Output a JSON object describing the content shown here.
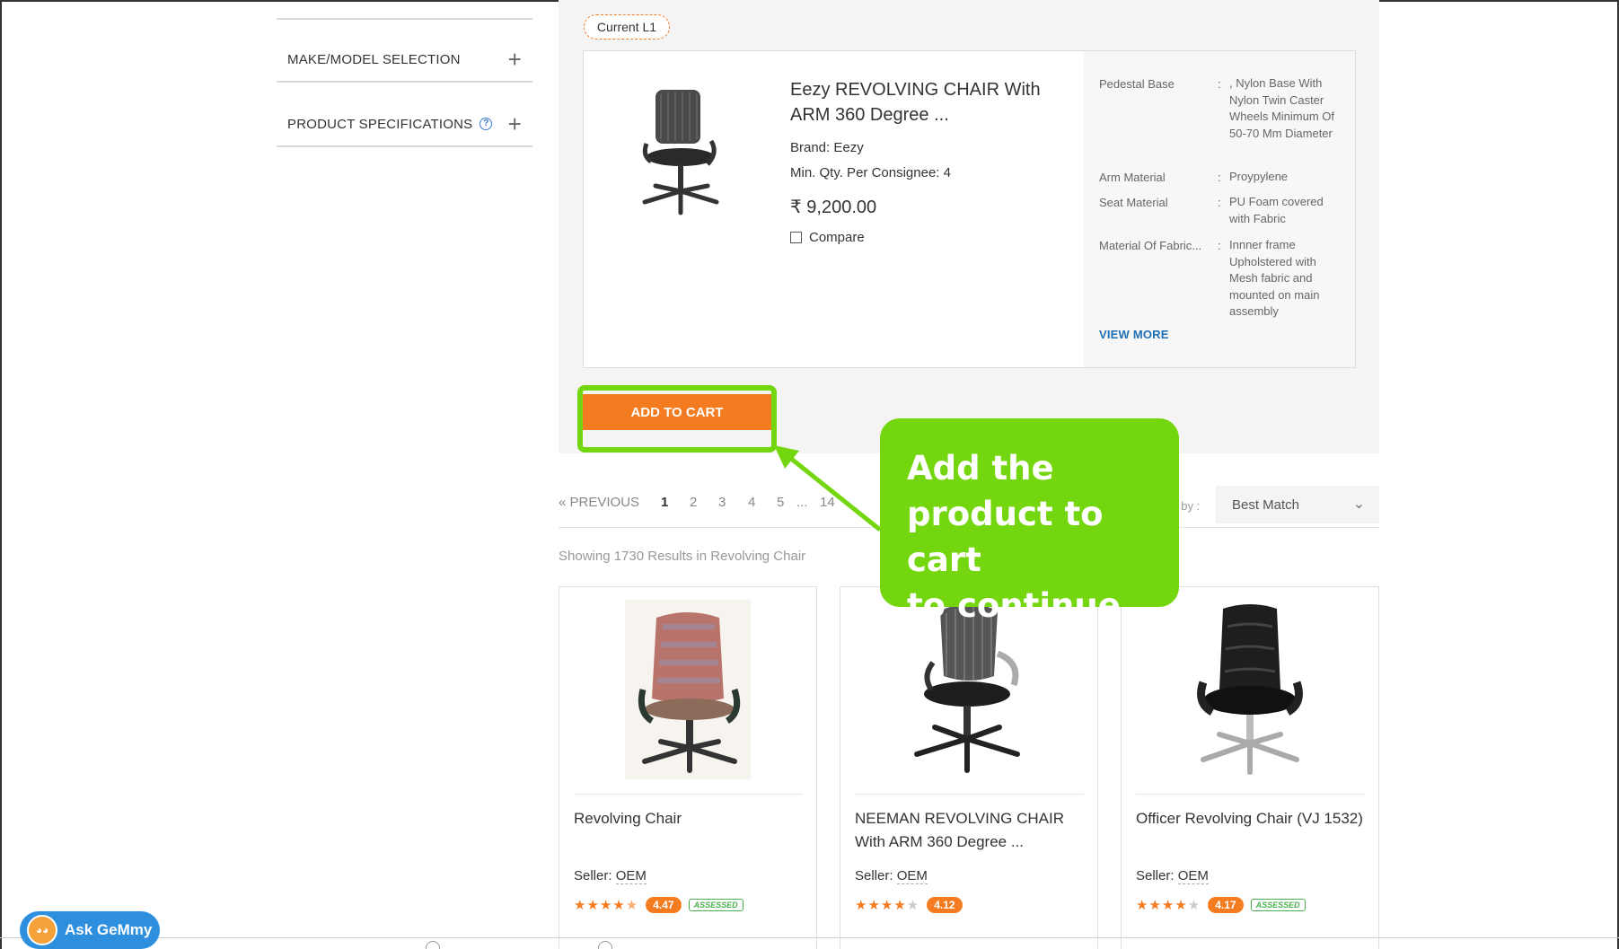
{
  "sidebar": {
    "items": [
      {
        "label": "MAKE/MODEL SELECTION"
      },
      {
        "label": "PRODUCT SPECIFICATIONS"
      }
    ]
  },
  "featured": {
    "tag": "Current L1",
    "title": "Eezy REVOLVING CHAIR With ARM 360 Degree ...",
    "brand": "Brand: Eezy",
    "min_qty": "Min. Qty. Per Consignee: 4",
    "price": "₹ 9,200.00",
    "compare_label": "Compare",
    "specs": [
      {
        "key": "Pedestal Base",
        "value": ", Nylon Base With Nylon Twin Caster Wheels Minimum Of 50-70 Mm Diameter"
      },
      {
        "key": "Arm Material",
        "value": "Proypylene"
      },
      {
        "key": "Seat Material",
        "value": "PU Foam covered with Fabric"
      },
      {
        "key": "Material Of Fabric...",
        "value": "Innner frame Upholstered with Mesh fabric and mounted on main assembly"
      }
    ],
    "view_more": "VIEW MORE",
    "add_to_cart": "ADD TO CART"
  },
  "callout": {
    "lines": [
      "Add the",
      "product to cart",
      "to continue."
    ]
  },
  "pagination": {
    "previous": "« PREVIOUS",
    "pages": [
      "1",
      "2",
      "3",
      "4",
      "5",
      "...",
      "14"
    ],
    "sort_label": "t by :",
    "sort_value": "Best Match"
  },
  "results_text": "Showing 1730 Results in Revolving Chair",
  "products": [
    {
      "title": "Revolving Chair",
      "seller_label": "Seller:",
      "seller": "OEM",
      "rating": "4.47",
      "stars": 4.5,
      "assessed": "ASSESSED"
    },
    {
      "title": "NEEMAN REVOLVING CHAIR With ARM 360 Degree ...",
      "seller_label": "Seller:",
      "seller": "OEM",
      "rating": "4.12",
      "stars": 4,
      "assessed": ""
    },
    {
      "title": "Officer Revolving Chair (VJ 1532)",
      "seller_label": "Seller:",
      "seller": "OEM",
      "rating": "4.17",
      "stars": 4,
      "assessed": "ASSESSED"
    }
  ],
  "assistant": {
    "label": "Ask GeMmy"
  },
  "colors": {
    "accent": "#f47b20",
    "highlight": "#74d60e",
    "link": "#1f6fb5"
  },
  "icons": [
    "plus-icon",
    "help-icon",
    "checkbox-icon",
    "chevron-down-icon",
    "star-icon",
    "assessed-badge-icon",
    "gemmy-avatar-icon"
  ]
}
